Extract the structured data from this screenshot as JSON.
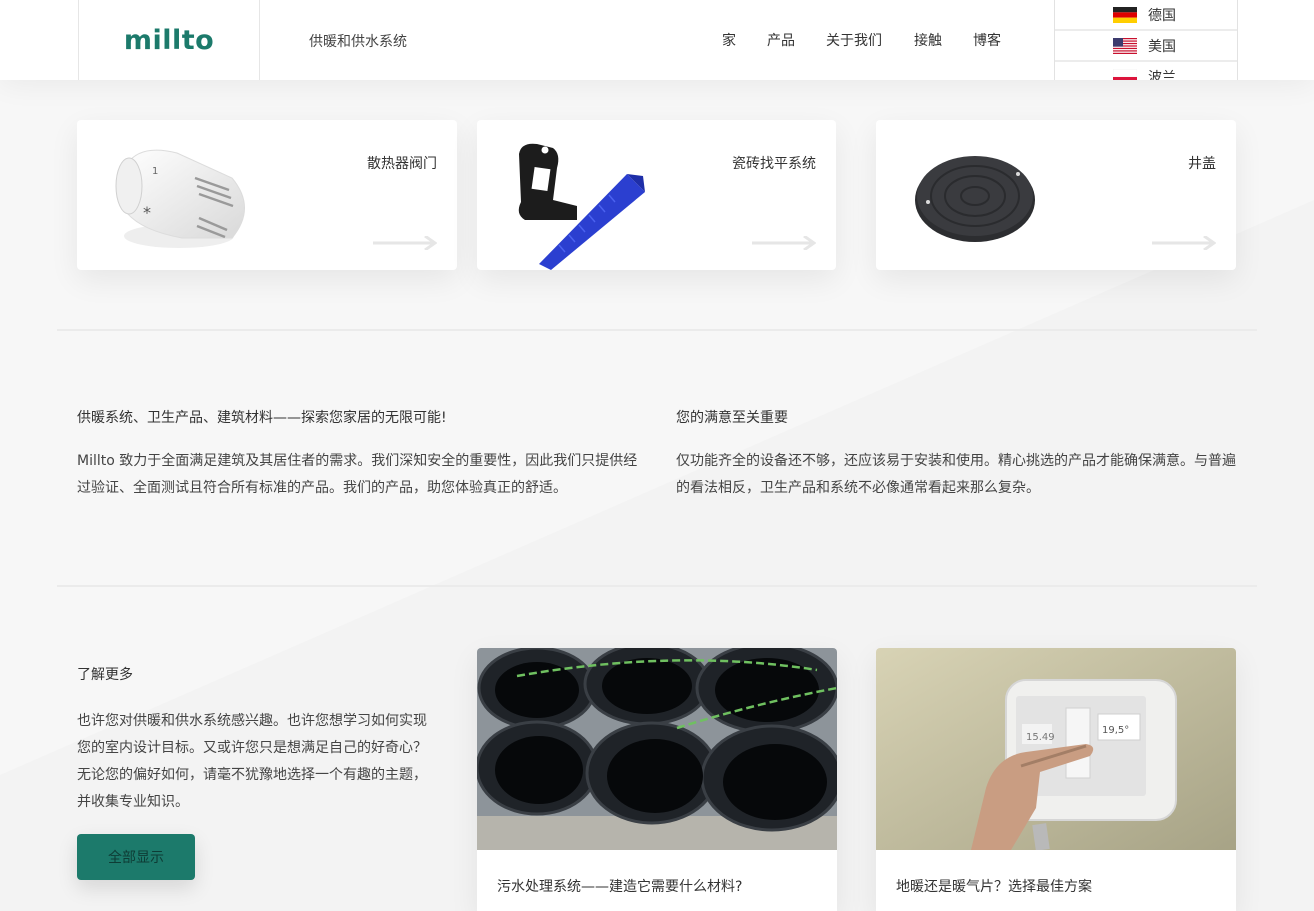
{
  "brand": {
    "logo": "millto",
    "tagline": "供暖和供水系统",
    "accent": "#1c7a6b"
  },
  "nav": [
    {
      "label": "家"
    },
    {
      "label": "产品"
    },
    {
      "label": "关于我们"
    },
    {
      "label": "接触"
    },
    {
      "label": "博客"
    }
  ],
  "languages": [
    {
      "label": "德国",
      "flag": "germany-flag-icon"
    },
    {
      "label": "美国",
      "flag": "usa-flag-icon"
    },
    {
      "label": "波兰",
      "flag": "poland-flag-icon"
    }
  ],
  "categories": [
    {
      "title": "散热器阀门",
      "image": "thermostatic-valve-head-image"
    },
    {
      "title": "瓷砖找平系统",
      "image": "tile-leveling-clip-wedge-image"
    },
    {
      "title": "井盖",
      "image": "manhole-cover-image"
    }
  ],
  "info": {
    "left": {
      "title": "供暖系统、卫生产品、建筑材料——探索您家居的无限可能!",
      "body": "Millto 致力于全面满足建筑及其居住者的需求。我们深知安全的重要性，因此我们只提供经过验证、全面测试且符合所有标准的产品。我们的产品，助您体验真正的舒适。"
    },
    "right": {
      "title": "您的满意至关重要",
      "body": "仅功能齐全的设备还不够，还应该易于安装和使用。精心挑选的产品才能确保满意。与普遍的看法相反，卫生产品和系统不必像通常看起来那么复杂。"
    }
  },
  "learn_more": {
    "title": "了解更多",
    "body": "也许您对供暖和供水系统感兴趣。也许您想学习如何实现您的室内设计目标。又或许您只是想满足自己的好奇心？无论您的偏好如何，请毫不犹豫地选择一个有趣的主题，并收集专业知识。",
    "button": "全部显示"
  },
  "blog_posts": [
    {
      "title": "污水处理系统——建造它需要什么材料?",
      "image": "corrugated-pipes-image"
    },
    {
      "title": "地暖还是暖气片？选择最佳方案",
      "image": "thermostat-touch-panel-image"
    }
  ]
}
